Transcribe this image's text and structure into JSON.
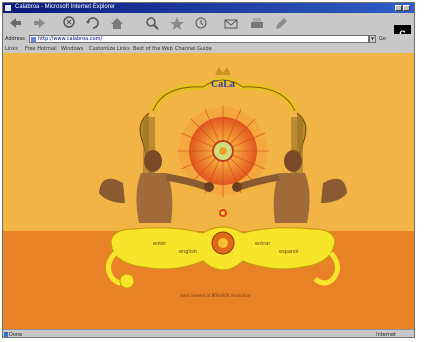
{
  "window": {
    "title": "Calabroa - Microsoft Internet Explorer"
  },
  "toolbar": {
    "buttons": [
      "back-icon",
      "forward-icon",
      "stop-icon",
      "refresh-icon",
      "home-icon",
      "search-icon",
      "favorites-icon",
      "history-icon",
      "mail-icon",
      "print-icon",
      "edit-icon"
    ],
    "throbber_label": "C"
  },
  "address": {
    "label": "Address",
    "url": "http://www.calabroa.com/",
    "go_label": "Go"
  },
  "links": {
    "items": [
      "Links",
      "Free Hotmail",
      "Windows",
      "Customize Links",
      "Best of the Web",
      "Channel Guide"
    ]
  },
  "page": {
    "logo": "CaLa",
    "menu_left": [
      "enter",
      "english"
    ],
    "menu_right": [
      "entrar",
      "espanol"
    ],
    "footer_text": "best viewed at 800x600 resolution"
  },
  "statusbar": {
    "status": "Done",
    "zone": "Internet"
  },
  "colors": {
    "upper_background": "#f2b445",
    "lower_background": "#e98227",
    "ornament_yellow": "#f7e52a",
    "title_bar": "#0a1a78"
  }
}
